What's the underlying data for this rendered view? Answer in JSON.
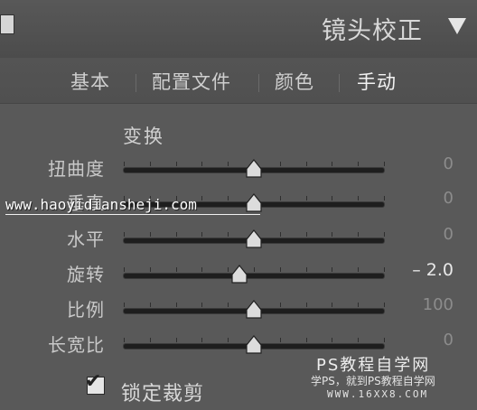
{
  "header": {
    "title": "镜头校正",
    "collapse_icon": "triangle-down-icon"
  },
  "tabs": [
    {
      "label": "基本",
      "active": false
    },
    {
      "label": "配置文件",
      "active": false
    },
    {
      "label": "颜色",
      "active": false
    },
    {
      "label": "手动",
      "active": true
    }
  ],
  "section": {
    "title": "变换",
    "sliders": [
      {
        "label": "扭曲度",
        "value": "0",
        "level": 0,
        "changed": false
      },
      {
        "label": "垂直",
        "value": "0",
        "level": 0,
        "changed": false
      },
      {
        "label": "水平",
        "value": "0",
        "level": 0,
        "changed": false
      },
      {
        "label": "旋转",
        "value": "– 2.0",
        "level": -2.0,
        "changed": true
      },
      {
        "label": "比例",
        "value": "100",
        "level": 0,
        "changed": false
      },
      {
        "label": "长宽比",
        "value": "0",
        "level": 0,
        "changed": false
      }
    ]
  },
  "crop_lock": {
    "label": "锁定裁剪",
    "checked": true
  },
  "watermark": {
    "url": "www.haoyidiansheji.com",
    "brand": "PS教程自学网",
    "tagline": "学PS，就到PS教程自学网",
    "site": "WWW.16XX8.COM"
  },
  "colors": {
    "track": "#1e1e1e",
    "thumb": "#dcdcdc",
    "panel": "#595959"
  }
}
